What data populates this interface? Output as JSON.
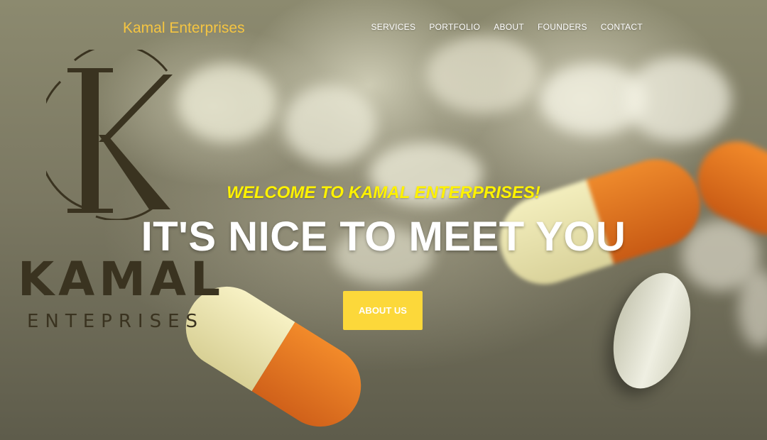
{
  "nav": {
    "brand": "Kamal Enterprises",
    "links": [
      "SERVICES",
      "PORTFOLIO",
      "ABOUT",
      "FOUNDERS",
      "CONTACT"
    ]
  },
  "logo": {
    "monogram": "K",
    "word": "KAMAL",
    "sub": "ENTEPRISES"
  },
  "hero": {
    "subheading": "WELCOME TO KAMAL ENTERPRISES!",
    "heading": "IT'S NICE TO MEET YOU",
    "button": "ABOUT US"
  },
  "colors": {
    "brand": "#f5c542",
    "subheading": "#fff200",
    "button": "#fcd83a",
    "logo": "#3a3320"
  }
}
